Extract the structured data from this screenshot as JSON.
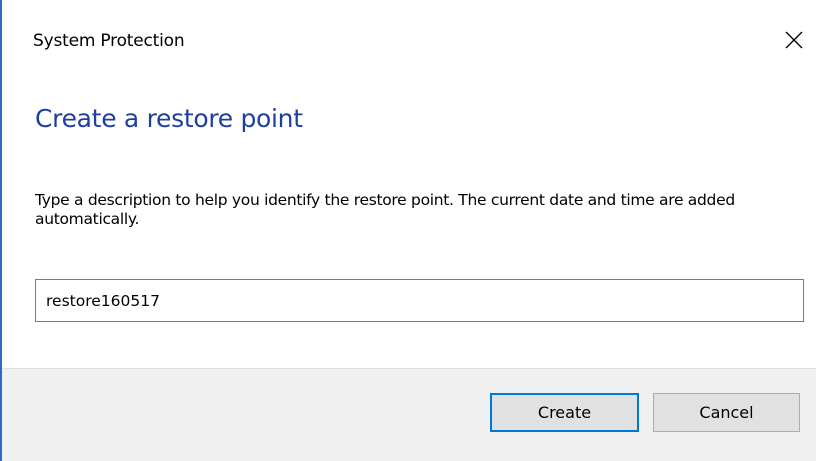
{
  "window": {
    "title": "System Protection",
    "close_icon": "close-icon"
  },
  "main": {
    "heading": "Create a restore point",
    "instructions": "Type a description to help you identify the restore point. The current date and time are added automatically.",
    "description_input": {
      "value": "restore160517",
      "placeholder": ""
    }
  },
  "footer": {
    "create_label": "Create",
    "cancel_label": "Cancel"
  },
  "colors": {
    "heading": "#1e3f9e",
    "accent": "#0078d7",
    "window_border": "#2b6cc4",
    "footer_bg": "#f0f0f0"
  }
}
